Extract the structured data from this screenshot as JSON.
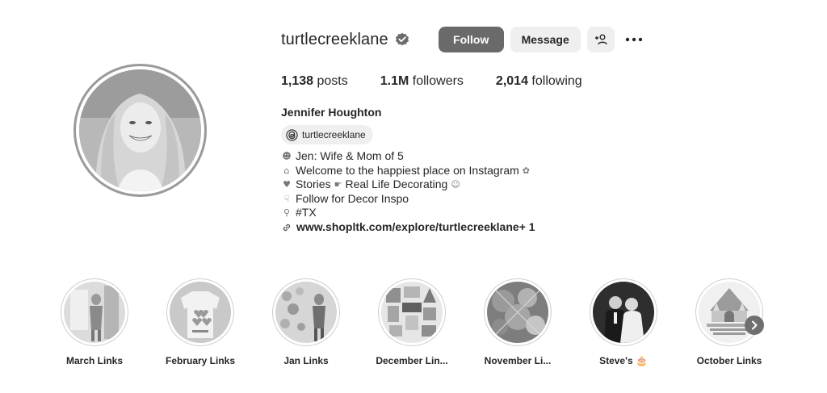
{
  "profile": {
    "username": "turtlecreeklane",
    "verified_icon": "verified-badge-icon",
    "follow_label": "Follow",
    "message_label": "Message",
    "add_user_icon": "add-user-icon",
    "more_icon": "more-options-icon",
    "avatar_icon": "profile-photo"
  },
  "stats": {
    "posts_count": "1,138",
    "posts_label": "posts",
    "followers_count": "1.1M",
    "followers_label": "followers",
    "following_count": "2,014",
    "following_label": "following"
  },
  "bio": {
    "full_name": "Jennifer Houghton",
    "threads_handle": "turtlecreeklane",
    "threads_icon": "threads-icon",
    "lines": [
      {
        "prefix": "☻",
        "text": "Jen: Wife & Mom of 5",
        "suffix": ""
      },
      {
        "prefix": "⌂",
        "text": "Welcome to the happiest place on Instagram",
        "suffix": "✿"
      },
      {
        "prefix": "♥",
        "text": "Stories",
        "mid": "☛",
        "text2": "Real Life Decorating",
        "suffix": "☺"
      },
      {
        "prefix": "☟",
        "text": "Follow for Decor Inspo",
        "suffix": ""
      },
      {
        "prefix": "⚲",
        "text": "#TX",
        "suffix": ""
      }
    ],
    "link_text": "www.shopltk.com/explore/turtlecreeklane",
    "link_more": " + 1",
    "link_icon": "link-icon"
  },
  "highlights": [
    {
      "label": "March Links"
    },
    {
      "label": "February Links"
    },
    {
      "label": "Jan Links"
    },
    {
      "label": "December Lin..."
    },
    {
      "label": "November Li..."
    },
    {
      "label": "Steve's 🎂"
    },
    {
      "label": "October Links"
    }
  ],
  "highlights_next_icon": "chevron-right-icon",
  "colors": {
    "follow_bg": "#6a6a6a",
    "button_bg": "#efefef",
    "text": "#262626"
  }
}
